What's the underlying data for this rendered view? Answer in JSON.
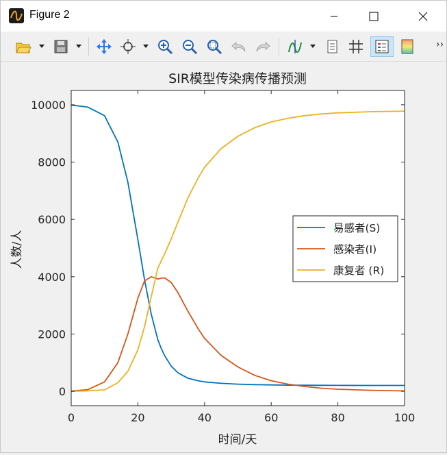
{
  "window": {
    "title": "Figure 2"
  },
  "toolbar": {
    "buttons": [
      "open-icon",
      "save-icon",
      "pan-icon",
      "move-icon",
      "zoom-in-icon",
      "zoom-out-icon",
      "zoom-fit-icon",
      "undo-icon",
      "redo-icon",
      "curve-icon",
      "text-icon",
      "grid-icon",
      "legend-icon",
      "colormap-icon"
    ],
    "overflow": "››"
  },
  "chart_data": {
    "type": "line",
    "title": "SIR模型传染病传播预测",
    "xlabel": "时间/天",
    "ylabel": "人数/人",
    "xlim": [
      0,
      100
    ],
    "ylim": [
      -500,
      10500
    ],
    "xticks": [
      0,
      20,
      40,
      60,
      80,
      100
    ],
    "yticks": [
      0,
      2000,
      4000,
      6000,
      8000,
      10000
    ],
    "legend_position": "center-right",
    "x": [
      0,
      5,
      10,
      14,
      17,
      20,
      22,
      24,
      26,
      27,
      28,
      30,
      32,
      35,
      38,
      40,
      45,
      50,
      55,
      60,
      65,
      70,
      75,
      80,
      90,
      100
    ],
    "series": [
      {
        "name": "易感者(S)",
        "color": "#0072bd",
        "values": [
          9990,
          9920,
          9620,
          8700,
          7300,
          5300,
          3900,
          2700,
          1800,
          1500,
          1250,
          880,
          650,
          460,
          370,
          330,
          280,
          250,
          235,
          225,
          215,
          212,
          210,
          208,
          206,
          205
        ]
      },
      {
        "name": "感染者(I)",
        "color": "#d95319",
        "values": [
          10,
          60,
          330,
          1000,
          2000,
          3250,
          3850,
          4000,
          3920,
          3950,
          3960,
          3800,
          3450,
          2800,
          2200,
          1850,
          1250,
          850,
          560,
          370,
          250,
          170,
          110,
          75,
          35,
          15
        ]
      },
      {
        "name": "康复者 (R)",
        "color": "#edb120",
        "values": [
          0,
          20,
          50,
          300,
          700,
          1450,
          2250,
          3300,
          4300,
          4550,
          4790,
          5320,
          5900,
          6740,
          7430,
          7820,
          8470,
          8900,
          9200,
          9400,
          9530,
          9620,
          9680,
          9717,
          9759,
          9780
        ]
      }
    ]
  }
}
